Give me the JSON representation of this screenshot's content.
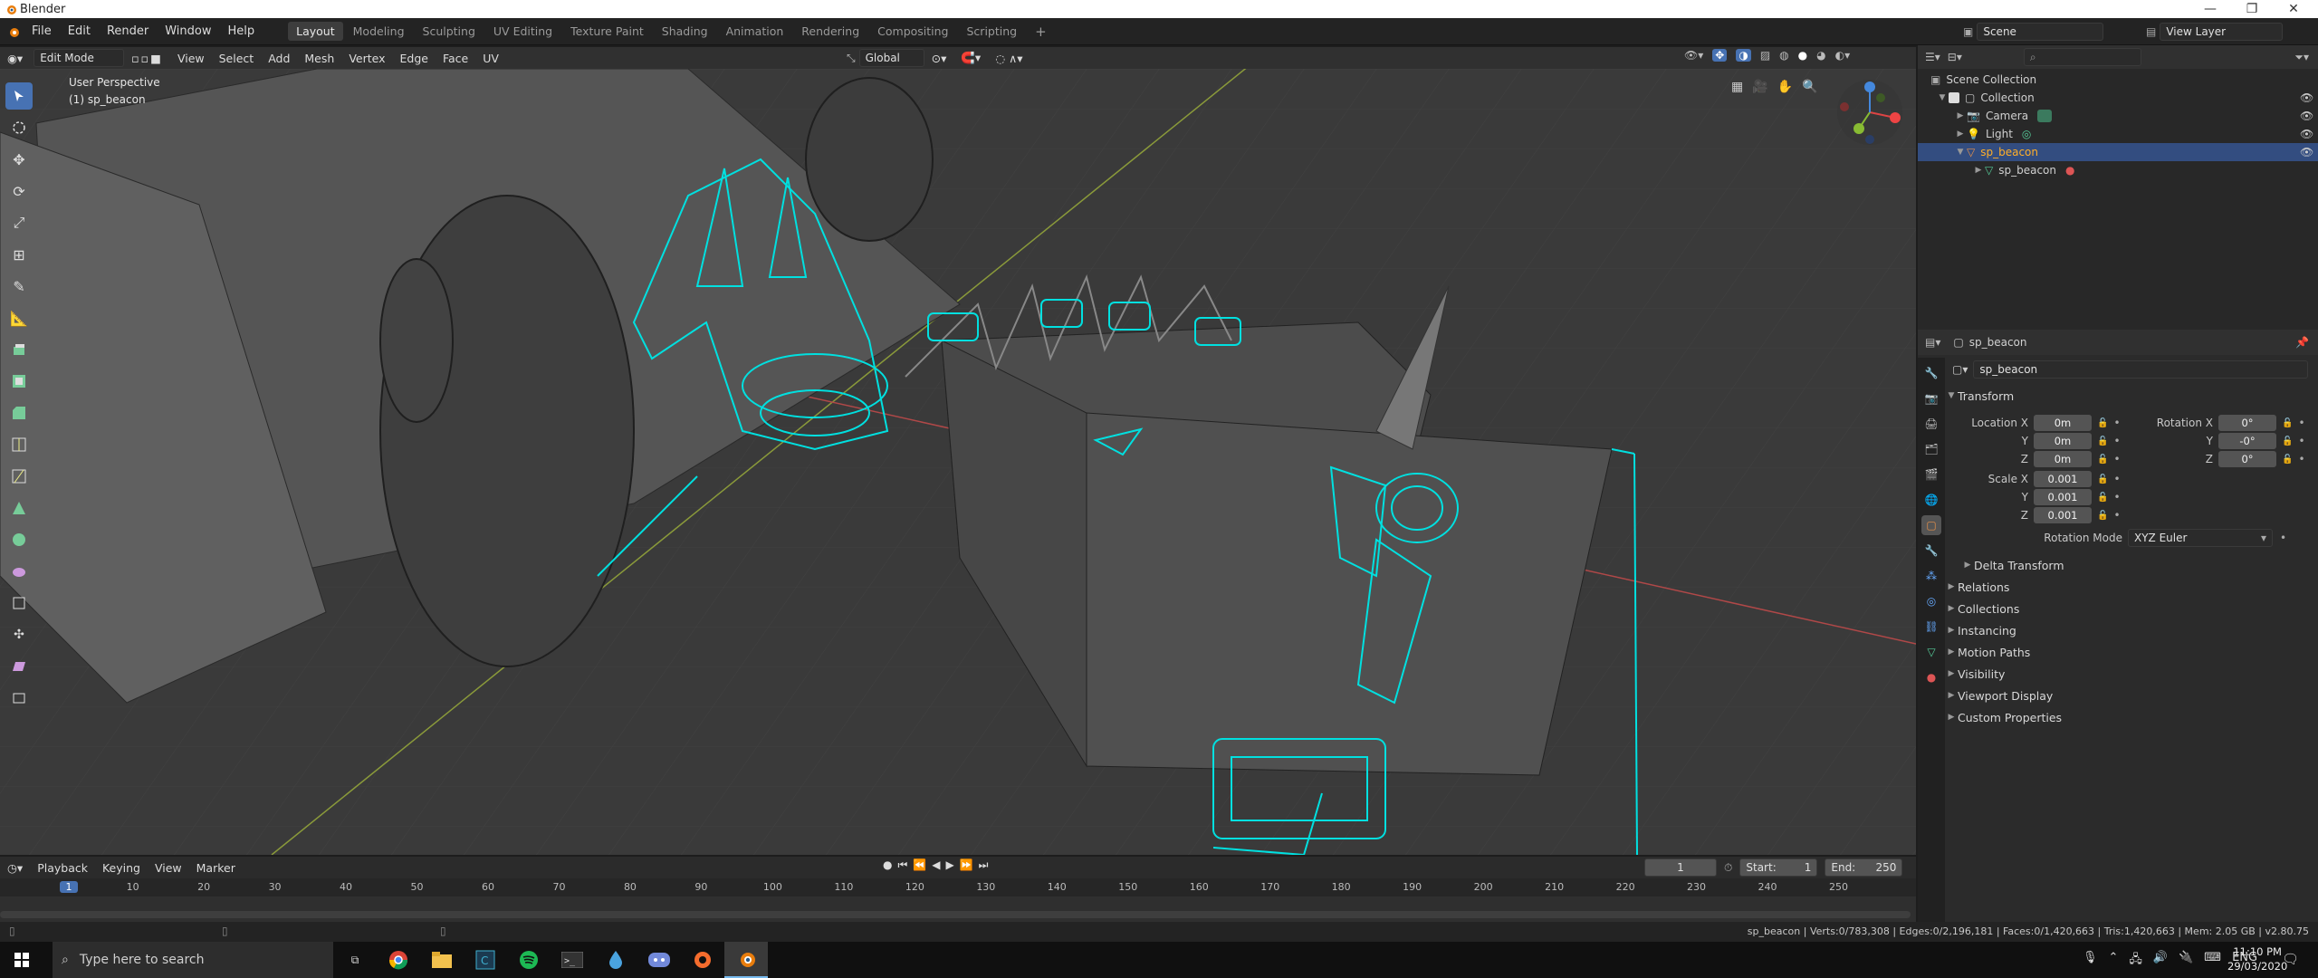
{
  "window": {
    "title": "Blender"
  },
  "menubar": {
    "menus": [
      "File",
      "Edit",
      "Render",
      "Window",
      "Help"
    ],
    "workspaces": [
      "Layout",
      "Modeling",
      "Sculpting",
      "UV Editing",
      "Texture Paint",
      "Shading",
      "Animation",
      "Rendering",
      "Compositing",
      "Scripting"
    ],
    "active_workspace": "Layout",
    "scene": "Scene",
    "view_layer": "View Layer"
  },
  "viewport_header": {
    "mode": "Edit Mode",
    "menus": [
      "View",
      "Select",
      "Add",
      "Mesh",
      "Vertex",
      "Edge",
      "Face",
      "UV"
    ],
    "orientation": "Global"
  },
  "viewport": {
    "perspective": "User Perspective",
    "object_info": "(1) sp_beacon",
    "colors": {
      "background": "#3a3a3a",
      "wire": "#00e0e0",
      "x_axis": "#b04848",
      "y_axis": "#8a9a3a"
    }
  },
  "outliner": {
    "root": "Scene Collection",
    "items": [
      {
        "label": "Collection"
      },
      {
        "label": "Camera"
      },
      {
        "label": "Light"
      },
      {
        "label": "sp_beacon"
      },
      {
        "label": "sp_beacon"
      }
    ]
  },
  "properties": {
    "object_name": "sp_beacon",
    "data_name": "sp_beacon",
    "transform_label": "Transform",
    "location": {
      "label": "Location X",
      "x": "0m",
      "y": "0m",
      "z": "0m"
    },
    "rotation": {
      "label": "Rotation X",
      "x": "0°",
      "y": "-0°",
      "z": "0°"
    },
    "scale": {
      "label": "Scale X",
      "x": "0.001",
      "y": "0.001",
      "z": "0.001"
    },
    "axis_y": "Y",
    "axis_z": "Z",
    "rotation_mode_label": "Rotation Mode",
    "rotation_mode": "XYZ Euler",
    "delta_transform": "Delta Transform",
    "sections": [
      "Relations",
      "Collections",
      "Instancing",
      "Motion Paths",
      "Visibility",
      "Viewport Display",
      "Custom Properties"
    ]
  },
  "timeline": {
    "menus": [
      "Playback",
      "Keying",
      "View",
      "Marker"
    ],
    "current_frame": "1",
    "start_label": "Start:",
    "start": "1",
    "end_label": "End:",
    "end": "250",
    "ticks": [
      "1",
      "10",
      "20",
      "30",
      "40",
      "50",
      "60",
      "70",
      "80",
      "90",
      "100",
      "110",
      "120",
      "130",
      "140",
      "150",
      "160",
      "170",
      "180",
      "190",
      "200",
      "210",
      "220",
      "230",
      "240",
      "250"
    ]
  },
  "statusbar": {
    "text": "sp_beacon | Verts:0/783,308 | Edges:0/2,196,181 | Faces:0/1,420,663 | Tris:1,420,663 | Mem: 2.05 GB | v2.80.75"
  },
  "taskbar": {
    "search_placeholder": "Type here to search",
    "lang": "ENG",
    "time": "11:10 PM",
    "date": "29/03/2020"
  }
}
